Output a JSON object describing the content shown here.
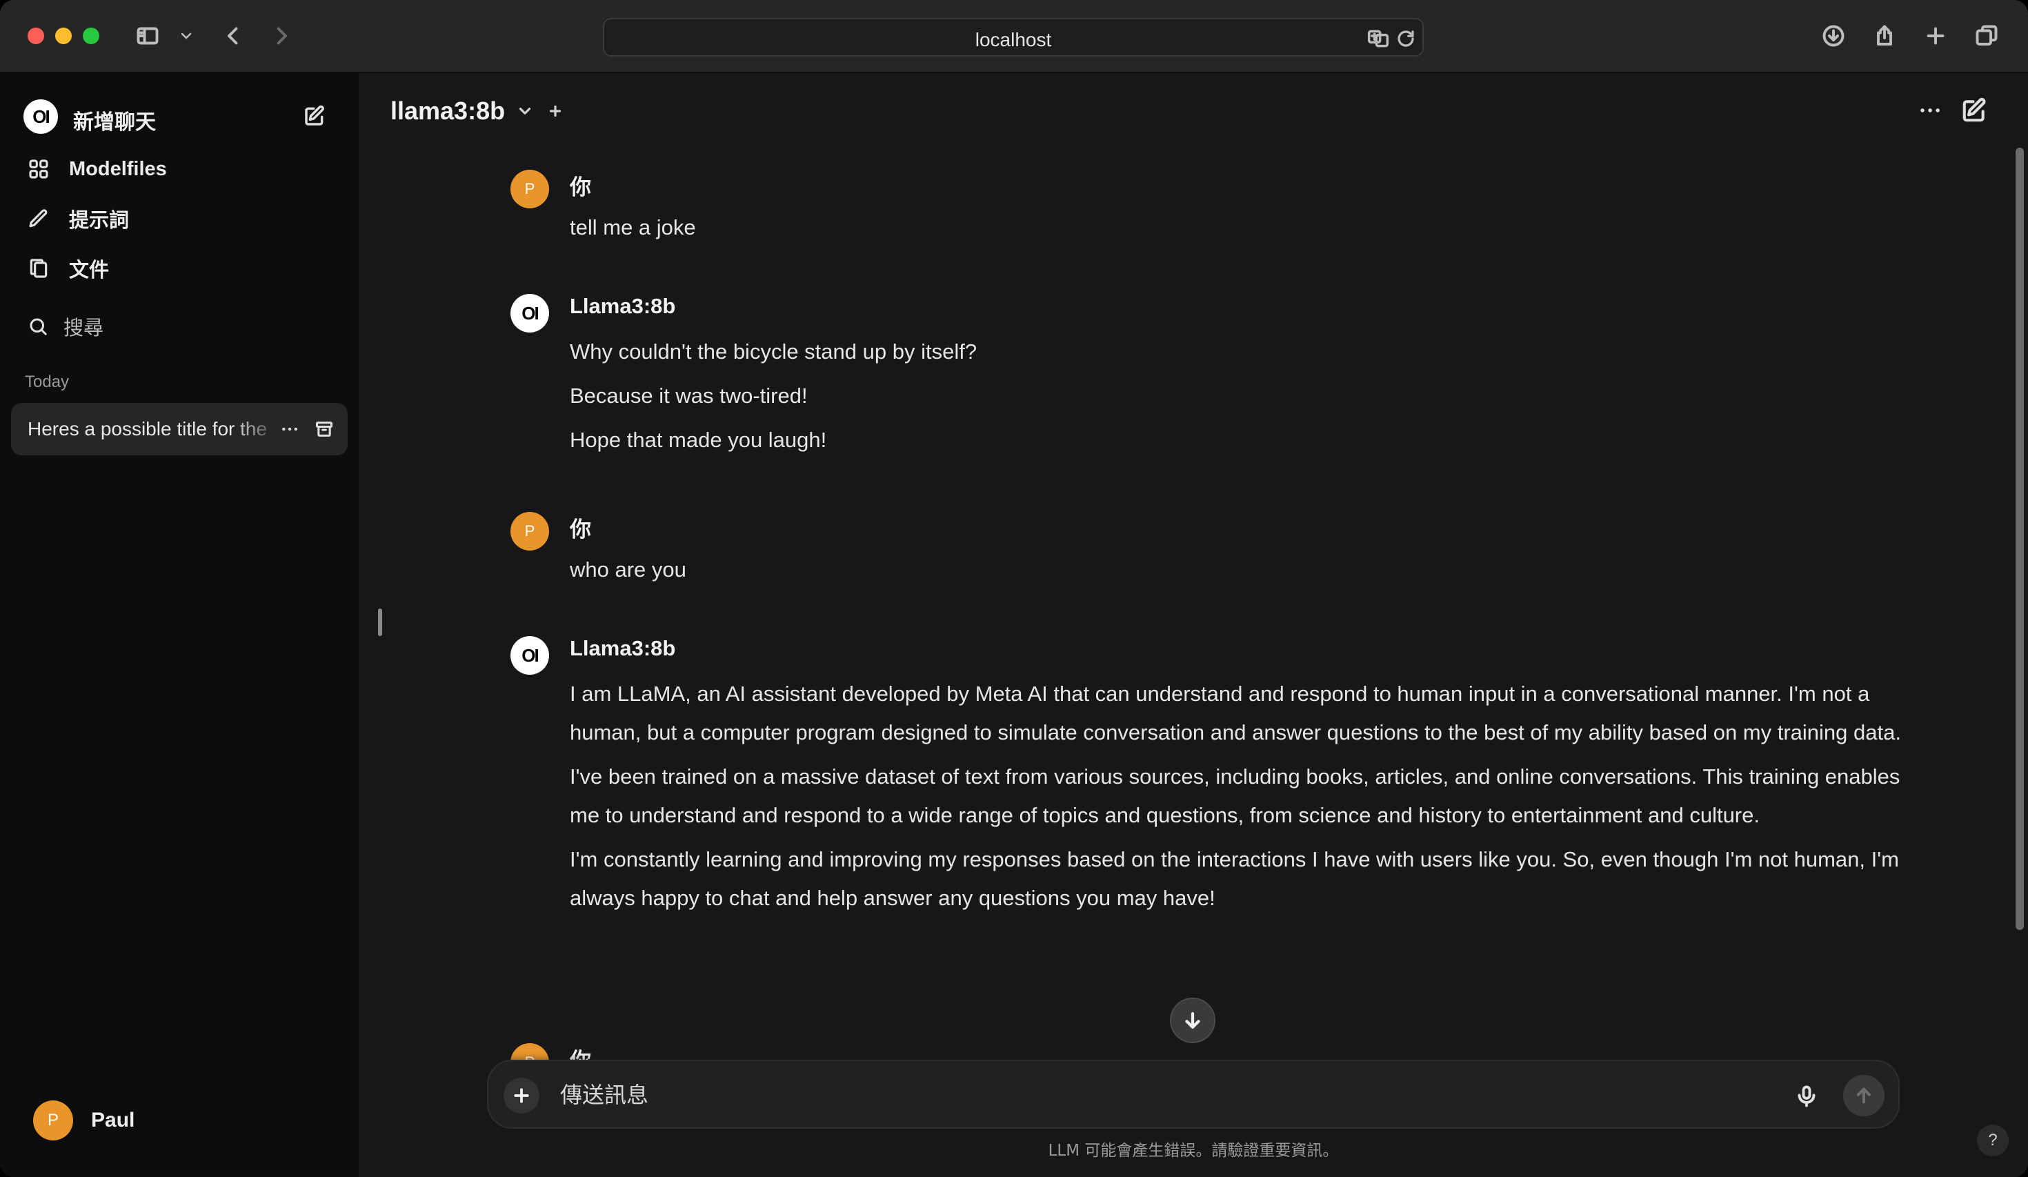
{
  "browser": {
    "address": "localhost"
  },
  "sidebar": {
    "logo_text": "OI",
    "new_chat_label": "新增聊天",
    "nav": [
      {
        "label": "Modelfiles",
        "icon": "modelfiles-icon"
      },
      {
        "label": "提示詞",
        "icon": "pencil-icon"
      },
      {
        "label": "文件",
        "icon": "documents-icon"
      }
    ],
    "search_label": "搜尋",
    "section_today": "Today",
    "chats": [
      {
        "title": "Heres a possible title for the"
      }
    ],
    "user": {
      "initial": "P",
      "name": "Paul"
    }
  },
  "header": {
    "model_name": "llama3:8b",
    "add_model_label": "+"
  },
  "messages": [
    {
      "role": "user",
      "avatar": "P",
      "name": "你",
      "paragraphs": [
        "tell me a joke"
      ]
    },
    {
      "role": "assistant",
      "avatar": "OI",
      "name": "Llama3:8b",
      "paragraphs": [
        "Why couldn't the bicycle stand up by itself?",
        "Because it was two-tired!",
        "Hope that made you laugh!"
      ]
    },
    {
      "role": "user",
      "avatar": "P",
      "name": "你",
      "paragraphs": [
        "who are you"
      ]
    },
    {
      "role": "assistant",
      "avatar": "OI",
      "name": "Llama3:8b",
      "paragraphs": [
        "I am LLaMA, an AI assistant developed by Meta AI that can understand and respond to human input in a conversational manner. I'm not a human, but a computer program designed to simulate conversation and answer questions to the best of my ability based on my training data.",
        "I've been trained on a massive dataset of text from various sources, including books, articles, and online conversations. This training enables me to understand and respond to a wide range of topics and questions, from science and history to entertainment and culture.",
        "I'm constantly learning and improving my responses based on the interactions I have with users like you. So, even though I'm not human, I'm always happy to chat and help answer any questions you may have!"
      ]
    },
    {
      "role": "user",
      "avatar": "P",
      "name": "你",
      "paragraphs": []
    }
  ],
  "composer": {
    "placeholder": "傳送訊息"
  },
  "disclaimer": "LLM 可能會產生錯誤。請驗證重要資訊。",
  "help_label": "?",
  "colors": {
    "sidebar_bg": "#0d0d0d",
    "main_bg": "#171717",
    "user_avatar": "#e9952b",
    "selected_chat_bg": "#262626"
  }
}
